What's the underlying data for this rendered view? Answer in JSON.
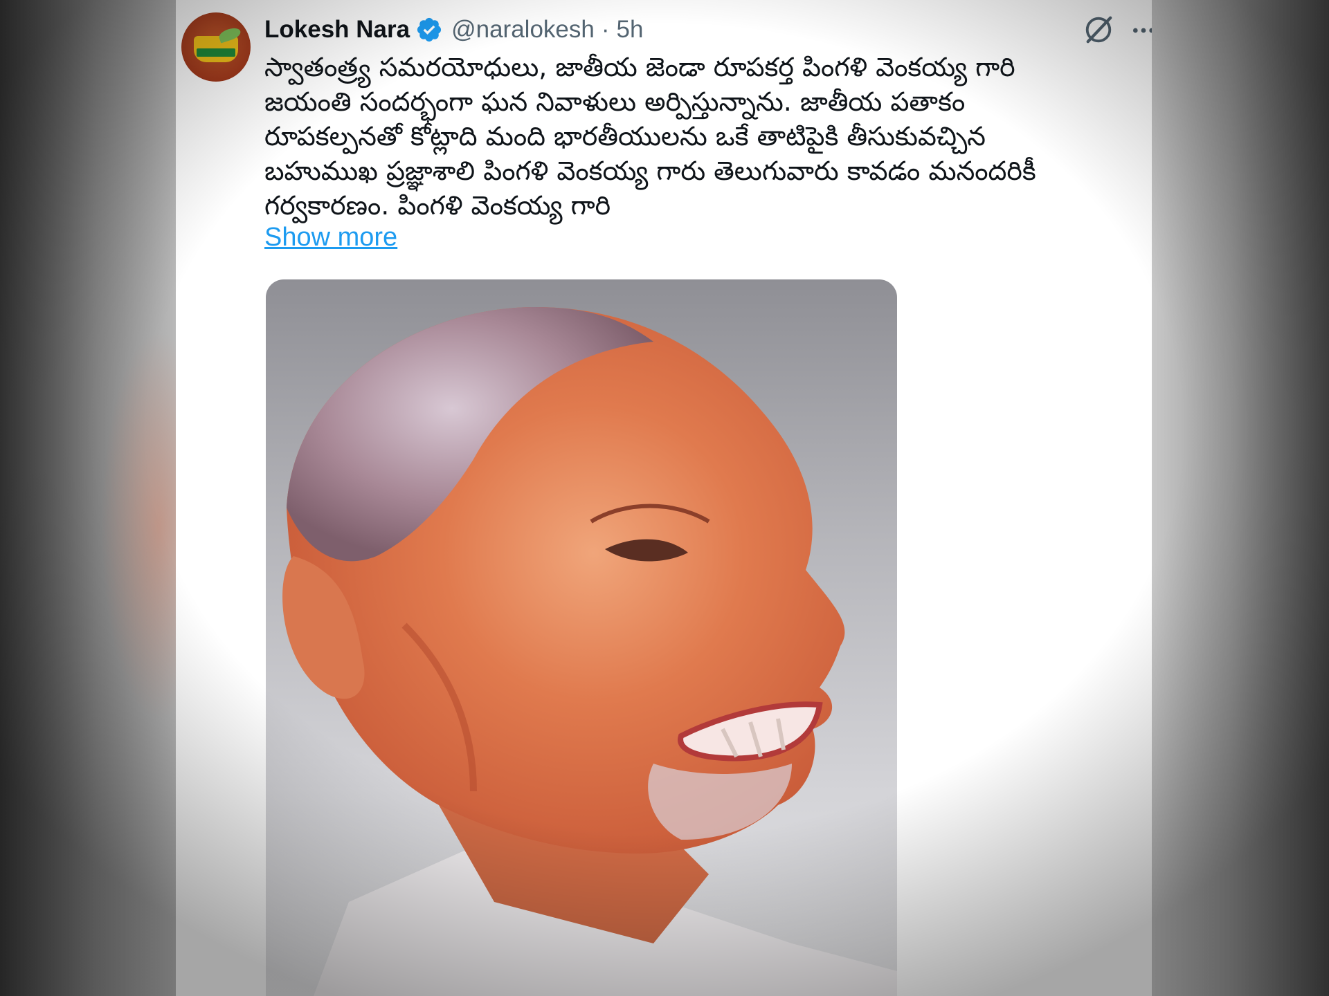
{
  "tweet": {
    "author_name": "Lokesh Nara",
    "handle": "@naralokesh",
    "separator": "·",
    "time": "5h",
    "text": "స్వాతంత్ర్య సమరయోధులు, జాతీయ జెండా రూపకర్త పింగళి వెంకయ్య గారి\nజయంతి సందర్భంగా ఘన నివాళులు అర్పిస్తున్నాను. జాతీయ పతాకం\nరూపకల్పనతో కోట్లాది మంది భారతీయులను ఒకే తాటిపైకి తీసుకువచ్చిన\nబహుముఖ ప్రజ్ఞాశాలి పింగళి వెంకయ్య గారు  తెలుగువారు కావడం మనందరికీ\nగర్వకారణం. పింగళి వెంకయ్య గారి",
    "show_more": "Show more",
    "icons": {
      "verified": "verified-badge-icon",
      "grok": "grok-icon",
      "more": "more-options-icon"
    },
    "colors": {
      "link": "#1d9bf0",
      "verified": "#1d9bf0",
      "text": "#0f1419",
      "secondary": "#536471"
    }
  }
}
